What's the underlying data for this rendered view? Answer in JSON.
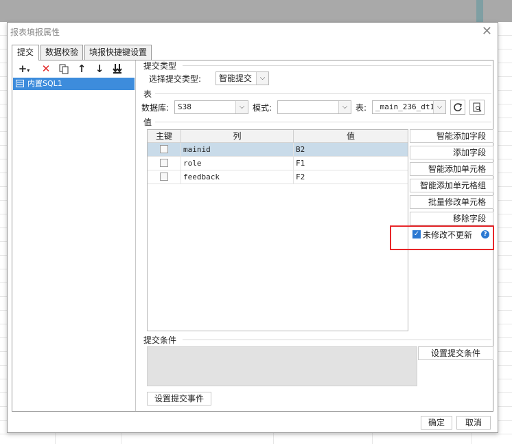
{
  "dialog": {
    "title": "报表填报属性",
    "close_glyph": "✕"
  },
  "tabs": [
    {
      "label": "提交",
      "active": true
    },
    {
      "label": "数据校验",
      "active": false
    },
    {
      "label": "填报快捷键设置",
      "active": false
    }
  ],
  "toolbar_icons": [
    "plus-dropdown-icon",
    "delete-icon",
    "copy-icon",
    "arrow-up-icon",
    "arrow-down-icon",
    "move-bottom-icon"
  ],
  "tree": {
    "items": [
      {
        "label": "内置SQL1",
        "selected": true
      }
    ]
  },
  "submit_type": {
    "section": "提交类型",
    "label": "选择提交类型:",
    "value": "智能提交"
  },
  "table_section": {
    "section": "表",
    "db_label": "数据库:",
    "db_value": "S38",
    "mode_label": "模式:",
    "mode_value": "",
    "table_label": "表:",
    "table_value": "_main_236_dt1"
  },
  "values_section": {
    "section": "值",
    "columns": [
      "主键",
      "列",
      "值"
    ],
    "rows": [
      {
        "column": "mainid",
        "value": "B2",
        "selected": true,
        "is_key": false
      },
      {
        "column": "role",
        "value": "F1",
        "selected": false,
        "is_key": false
      },
      {
        "column": "feedback",
        "value": "F2",
        "selected": false,
        "is_key": false
      }
    ]
  },
  "side_buttons": [
    "智能添加字段",
    "添加字段",
    "智能添加单元格",
    "智能添加单元格组",
    "批量修改单元格",
    "移除字段"
  ],
  "no_update_unmodified": {
    "label": "未修改不更新",
    "checked": true,
    "help_glyph": "?"
  },
  "condition_section": {
    "section": "提交条件",
    "button": "设置提交条件"
  },
  "submit_event_button": "设置提交事件",
  "footer": {
    "ok": "确定",
    "cancel": "取消"
  },
  "colors": {
    "selection": "#3d8cdc",
    "row_selected": "#c9dbe9",
    "checkbox": "#2a78d2",
    "highlight": "#e8272a",
    "delete_icon": "#e02020"
  }
}
